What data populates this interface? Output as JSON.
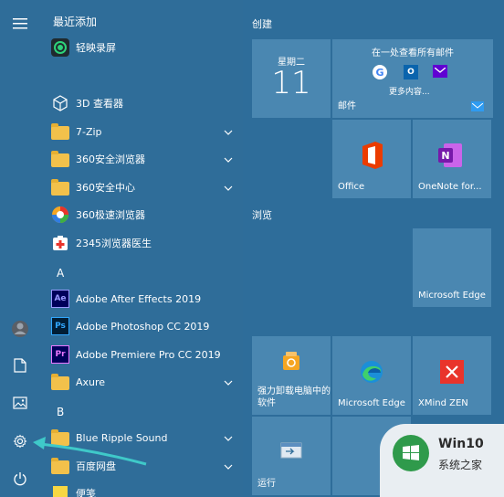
{
  "rail": {
    "items": [
      {
        "name": "hamburger-menu-icon"
      },
      {
        "name": "avatar"
      },
      {
        "name": "documents-icon"
      },
      {
        "name": "pictures-icon"
      },
      {
        "name": "gear-icon"
      },
      {
        "name": "power-icon"
      }
    ]
  },
  "app_list": {
    "recent_header": "最近添加",
    "items": [
      {
        "label": "轻映录屏"
      },
      {
        "label": "3D 查看器"
      },
      {
        "label": "7-Zip"
      },
      {
        "label": "360安全浏览器"
      },
      {
        "label": "360安全中心"
      },
      {
        "label": "360极速浏览器"
      },
      {
        "label": "2345浏览器医生"
      }
    ],
    "group_a": "A",
    "a_items": [
      {
        "label": "Adobe After Effects 2019",
        "icon_text": "Ae",
        "color": "#00005b",
        "fg": "#9999ff"
      },
      {
        "label": "Adobe Photoshop CC 2019",
        "icon_text": "Ps",
        "color": "#001e36",
        "fg": "#31a8ff"
      },
      {
        "label": "Adobe Premiere Pro CC 2019",
        "icon_text": "Pr",
        "color": "#00005b",
        "fg": "#ea77ff"
      },
      {
        "label": "Axure"
      }
    ],
    "group_b": "B",
    "b_items": [
      {
        "label": "Blue Ripple Sound"
      },
      {
        "label": "百度网盘"
      },
      {
        "label": "便笺"
      }
    ]
  },
  "tiles": {
    "section_create": "创建",
    "section_browse": "浏览",
    "calendar": {
      "weekday": "星期二",
      "day": "11"
    },
    "mail": {
      "heading": "在一处查看所有邮件",
      "more": "更多内容...",
      "label": "邮件"
    },
    "office": {
      "label": "Office"
    },
    "onenote": {
      "label": "OneNote for..."
    },
    "edge_top": {
      "label": "Microsoft Edge"
    },
    "uninstaller": {
      "label": "强力卸载电脑中的软件"
    },
    "edge_bottom": {
      "label": "Microsoft Edge"
    },
    "xmind": {
      "label": "XMind ZEN"
    },
    "run": {
      "label": "运行"
    }
  },
  "watermark": {
    "title": "Win10",
    "subtitle": "系统之家"
  },
  "colors": {
    "background": "#2e6d9a",
    "tile": "#4a87b1",
    "arrow": "#3fc9c9",
    "folder": "#f2c14b"
  }
}
